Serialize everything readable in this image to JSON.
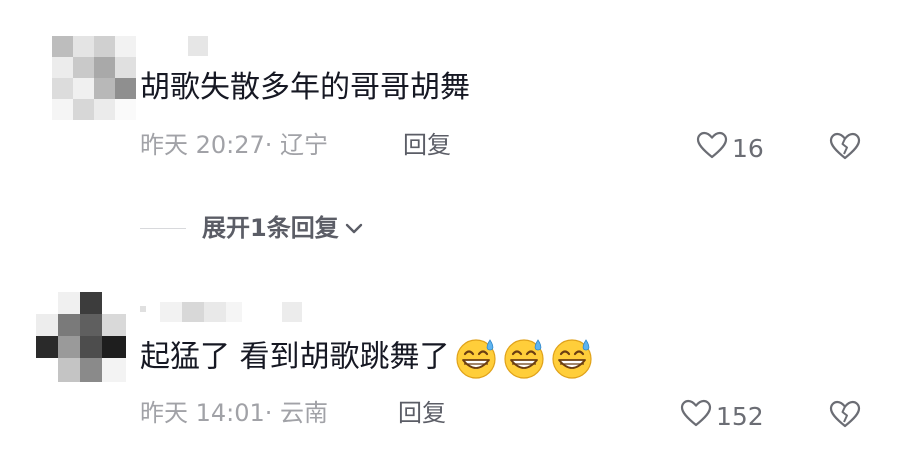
{
  "comments": [
    {
      "text": "胡歌失散多年的哥哥胡舞",
      "time": "昨天 20:27",
      "location": "· 辽宁",
      "reply_label": "回复",
      "likes": "16",
      "emoji_count": 0
    },
    {
      "text": "起猛了 看到胡歌跳舞了",
      "time": "昨天 14:01",
      "location": "· 云南",
      "reply_label": "回复",
      "likes": "152",
      "emoji_count": 3
    }
  ],
  "expand_replies": {
    "label": "展开1条回复"
  },
  "icons": {
    "like": "heart-outline-icon",
    "dislike": "broken-heart-icon",
    "expand": "chevron-down-icon",
    "emoji": "grinning-sweat-emoji"
  },
  "colors": {
    "text": "#161823",
    "meta": "#a1a2a7",
    "reply": "#5b5d66",
    "background": "#ffffff"
  }
}
